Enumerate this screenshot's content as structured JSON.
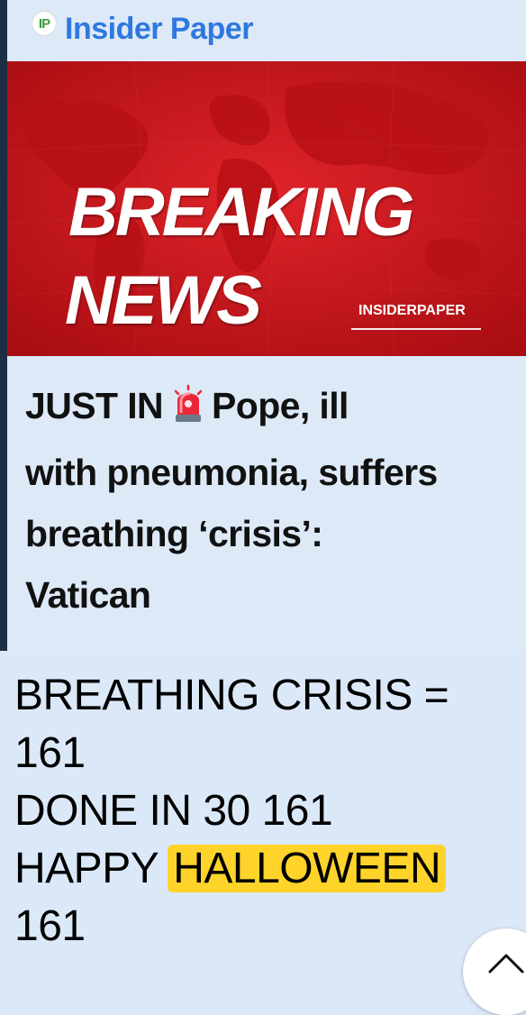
{
  "card": {
    "source_logo": "IP",
    "source_name": "Insider Paper",
    "image": {
      "line1": "BREAKING",
      "line2": "NEWS",
      "brand": "INSIDERPAPER"
    },
    "headline": {
      "prefix": "JUST IN",
      "emoji_icon": "police-siren-icon",
      "line1_rest": "Pope, ill",
      "line2": "with pneumonia, suffers",
      "line3": "breathing ‘crisis’:",
      "line4": "Vatican"
    }
  },
  "comment": {
    "line1": "BREATHING CRISIS =",
    "line2": "161",
    "line3": "DONE IN 30 161",
    "line4_prefix": "HAPPY",
    "line4_highlight": "HALLOWEEN",
    "line5": "161",
    "highlight_color": "#ffd42a"
  },
  "colors": {
    "source_name": "#2f78e0",
    "banner_red": "#c8141b"
  },
  "scroll_button_icon": "chevron-up-icon"
}
